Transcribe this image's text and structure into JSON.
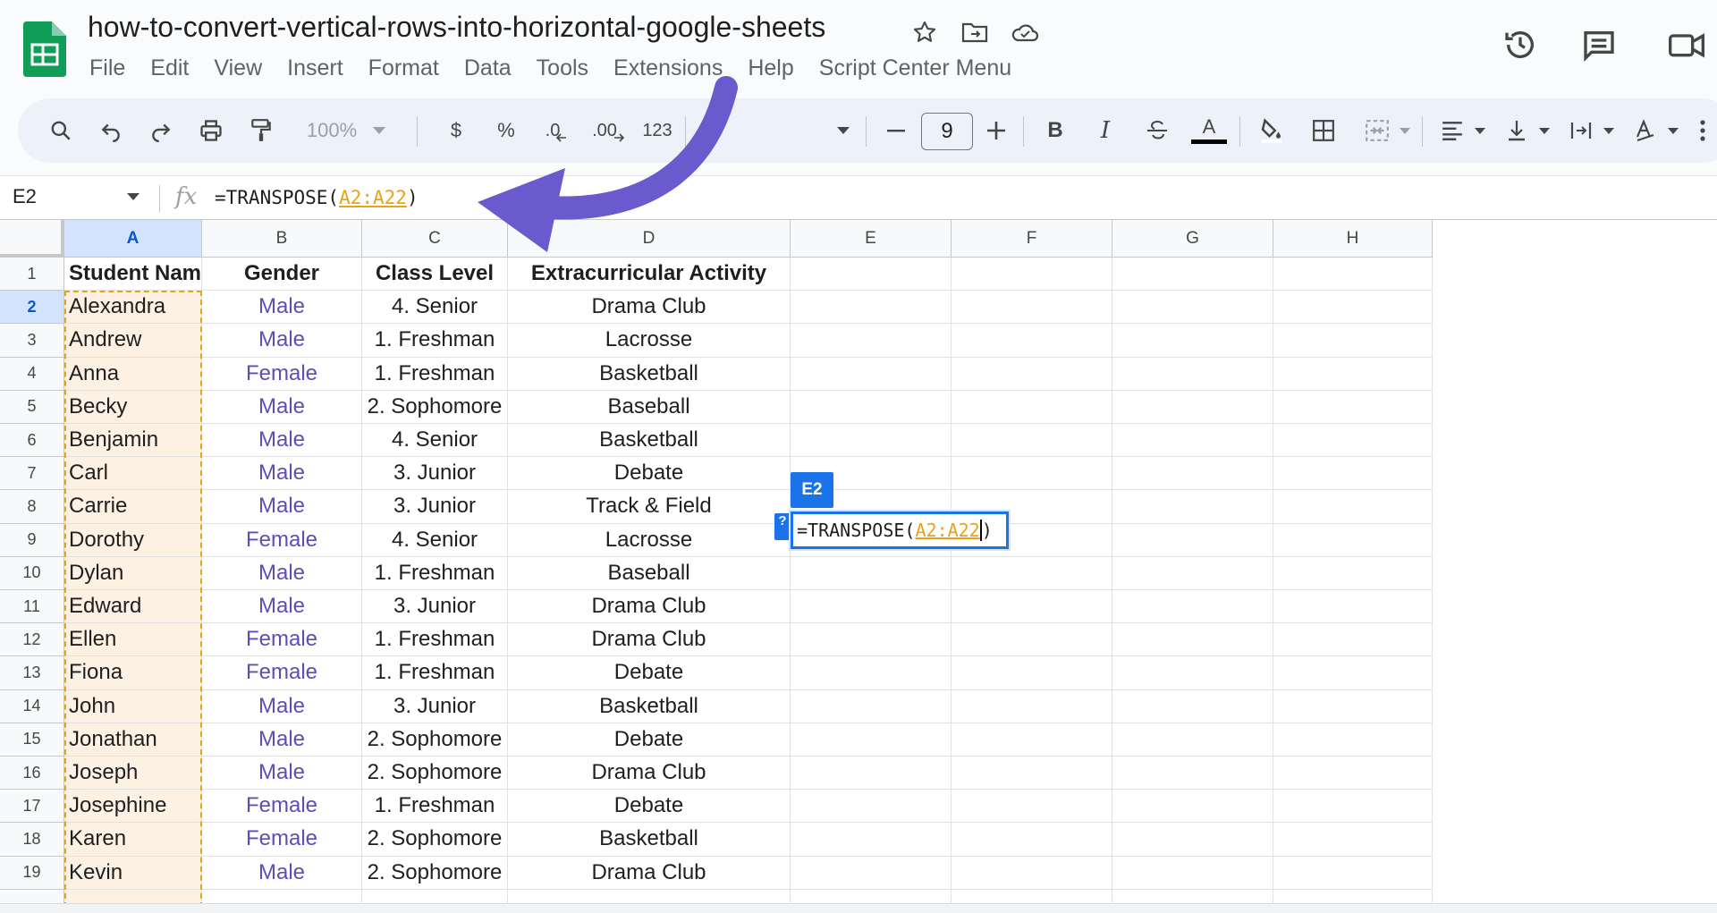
{
  "app": {
    "title": "how-to-convert-vertical-rows-into-horizontal-google-sheets",
    "menu": [
      "File",
      "Edit",
      "View",
      "Insert",
      "Format",
      "Data",
      "Tools",
      "Extensions",
      "Help",
      "Script Center Menu"
    ]
  },
  "toolbar": {
    "zoom": "100%",
    "currency": "$",
    "percent": "%",
    "decrease_decimal": ".0",
    "increase_decimal": ".00",
    "number_format": "123",
    "font_size": "9",
    "bold": "B",
    "italic": "I",
    "text_color": "A"
  },
  "formula_bar": {
    "name_box": "E2",
    "fx": "fx",
    "formula_prefix": "=TRANSPOSE(",
    "formula_ref": "A2:A22",
    "formula_suffix": ")"
  },
  "grid": {
    "columns": [
      "A",
      "B",
      "C",
      "D",
      "E",
      "F",
      "G",
      "H"
    ],
    "selected_column": "A",
    "headers": [
      "Student Name",
      "Gender",
      "Class Level",
      "Extracurricular Activity"
    ],
    "rows": [
      {
        "n": "2",
        "name": "Alexandra",
        "gender": "Male",
        "level": "4. Senior",
        "activity": "Drama Club"
      },
      {
        "n": "3",
        "name": "Andrew",
        "gender": "Male",
        "level": "1. Freshman",
        "activity": "Lacrosse"
      },
      {
        "n": "4",
        "name": "Anna",
        "gender": "Female",
        "level": "1. Freshman",
        "activity": "Basketball"
      },
      {
        "n": "5",
        "name": "Becky",
        "gender": "Male",
        "level": "2. Sophomore",
        "activity": "Baseball"
      },
      {
        "n": "6",
        "name": "Benjamin",
        "gender": "Male",
        "level": "4. Senior",
        "activity": "Basketball"
      },
      {
        "n": "7",
        "name": "Carl",
        "gender": "Male",
        "level": "3. Junior",
        "activity": "Debate"
      },
      {
        "n": "8",
        "name": "Carrie",
        "gender": "Male",
        "level": "3. Junior",
        "activity": "Track & Field"
      },
      {
        "n": "9",
        "name": "Dorothy",
        "gender": "Female",
        "level": "4. Senior",
        "activity": "Lacrosse"
      },
      {
        "n": "10",
        "name": "Dylan",
        "gender": "Male",
        "level": "1. Freshman",
        "activity": "Baseball"
      },
      {
        "n": "11",
        "name": "Edward",
        "gender": "Male",
        "level": "3. Junior",
        "activity": "Drama Club"
      },
      {
        "n": "12",
        "name": "Ellen",
        "gender": "Female",
        "level": "1. Freshman",
        "activity": "Drama Club"
      },
      {
        "n": "13",
        "name": "Fiona",
        "gender": "Female",
        "level": "1. Freshman",
        "activity": "Debate"
      },
      {
        "n": "14",
        "name": "John",
        "gender": "Male",
        "level": "3. Junior",
        "activity": "Basketball"
      },
      {
        "n": "15",
        "name": "Jonathan",
        "gender": "Male",
        "level": "2. Sophomore",
        "activity": "Debate"
      },
      {
        "n": "16",
        "name": "Joseph",
        "gender": "Male",
        "level": "2. Sophomore",
        "activity": "Drama Club"
      },
      {
        "n": "17",
        "name": "Josephine",
        "gender": "Female",
        "level": "1. Freshman",
        "activity": "Debate"
      },
      {
        "n": "18",
        "name": "Karen",
        "gender": "Female",
        "level": "2. Sophomore",
        "activity": "Basketball"
      },
      {
        "n": "19",
        "name": "Kevin",
        "gender": "Male",
        "level": "2. Sophomore",
        "activity": "Drama Club"
      }
    ],
    "active_cell_tag": "E2",
    "editor_prefix": "=TRANSPOSE(",
    "editor_ref": "A2:A22",
    "editor_suffix": ")",
    "help_tag": "?"
  },
  "colors": {
    "accent": "#1a73e8",
    "range_highlight": "#e8a317",
    "annotation_arrow": "#6a5acd",
    "sheets_green": "#0f9d58"
  }
}
